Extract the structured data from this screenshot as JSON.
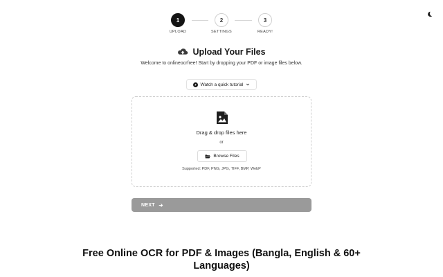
{
  "stepper": {
    "steps": [
      {
        "number": "1",
        "label": "UPLOAD",
        "active": true
      },
      {
        "number": "2",
        "label": "SETTINGS",
        "active": false
      },
      {
        "number": "3",
        "label": "READY!",
        "active": false
      }
    ]
  },
  "upload": {
    "title": "Upload Your Files",
    "subtitle": "Welcome to onlineocrfree! Start by dropping your PDF or image files below.",
    "tutorial_label": "Watch a quick tutorial"
  },
  "dropzone": {
    "drag_text": "Drag & drop files here",
    "or_text": "or",
    "browse_label": "Browse Files",
    "supported_text": "Supported: PDF, PNG, JPG, TIFF, BMP, WebP"
  },
  "next_label": "NEXT",
  "seo_title": "Free Online OCR for PDF & Images (Bangla, English & 60+ Languages)",
  "icons": {
    "theme": "moon-icon",
    "upload": "cloud-upload-icon",
    "tutorial": "play-circle-icon",
    "chevron": "chevron-down-icon",
    "file": "image-file-icon",
    "browse": "folder-open-icon",
    "next": "arrow-right-icon"
  },
  "colors": {
    "active_step": "#141414",
    "next_button": "#9a9a9a",
    "border": "#cfcfcf"
  }
}
